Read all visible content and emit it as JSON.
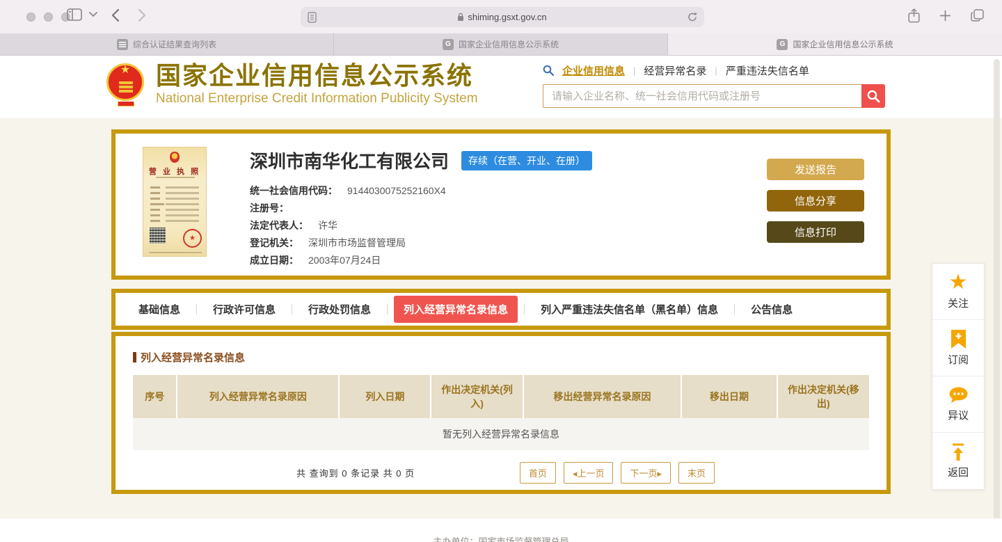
{
  "browser": {
    "url": "shiming.gsxt.gov.cn",
    "tabs": [
      {
        "label": "综合认证结果查询列表",
        "favicon": ""
      },
      {
        "label": "国家企业信用信息公示系统",
        "favicon": "G"
      },
      {
        "label": "国家企业信用信息公示系统",
        "favicon": "G"
      }
    ]
  },
  "site_header": {
    "title_cn": "国家企业信用信息公示系统",
    "title_en": "National Enterprise Credit Information Publicity System",
    "nav_links": [
      {
        "label": "企业信用信息",
        "active": true
      },
      {
        "label": "经营异常名录",
        "active": false
      },
      {
        "label": "严重违法失信名单",
        "active": false
      }
    ],
    "search_placeholder": "请输入企业名称、统一社会信用代码或注册号"
  },
  "company": {
    "name": "深圳市南华化工有限公司",
    "status_badge": "存续（在营、开业、在册）",
    "license_title": "营 业 执 照",
    "fields": [
      {
        "label": "统一社会信用代码：",
        "value": "9144030075252160X4"
      },
      {
        "label": "注册号：",
        "value": ""
      },
      {
        "label": "法定代表人：",
        "value": "许华"
      },
      {
        "label": "登记机关：",
        "value": "深圳市市场监督管理局"
      },
      {
        "label": "成立日期：",
        "value": "2003年07月24日"
      }
    ],
    "action_buttons": {
      "send": "发送报告",
      "share": "信息分享",
      "print": "信息打印"
    }
  },
  "section_tabs": [
    {
      "label": "基础信息",
      "active": false
    },
    {
      "label": "行政许可信息",
      "active": false
    },
    {
      "label": "行政处罚信息",
      "active": false
    },
    {
      "label": "列入经营异常名录信息",
      "active": true
    },
    {
      "label": "列入严重违法失信名单（黑名单）信息",
      "active": false
    },
    {
      "label": "公告信息",
      "active": false
    }
  ],
  "anomaly_section": {
    "title": "列入经营异常名录信息",
    "table_headers": [
      "序号",
      "列入经营异常名录原因",
      "列入日期",
      "作出决定机关(列入)",
      "移出经营异常名录原因",
      "移出日期",
      "作出决定机关(移出)"
    ],
    "empty_text": "暂无列入经营异常名录信息",
    "summary": "共 查询到 0 条记录 共 0 页",
    "pagination": {
      "first": "首页",
      "prev": "◂上一页",
      "next": "下一页▸",
      "last": "末页"
    }
  },
  "side_widget": [
    {
      "icon": "star-icon",
      "label": "关注"
    },
    {
      "icon": "bookmark-plus-icon",
      "label": "订阅"
    },
    {
      "icon": "chat-bubble-icon",
      "label": "异议"
    },
    {
      "icon": "back-to-top-icon",
      "label": "返回"
    }
  ],
  "footer": {
    "text": "主办单位：国家市场监督管理总局"
  },
  "colors": {
    "gold_border": "#C7990E",
    "brand_olive": "#8A7300",
    "brand_gold": "#C3A43E",
    "danger_red": "#EF504C",
    "active_tab_red": "#F0544F",
    "badge_blue": "#2E8CE0",
    "widget_orange": "#F7A600",
    "table_header_bg": "#E7DEC9",
    "btn_send": "#D3A94F",
    "btn_share": "#91650B",
    "btn_print": "#564818"
  }
}
